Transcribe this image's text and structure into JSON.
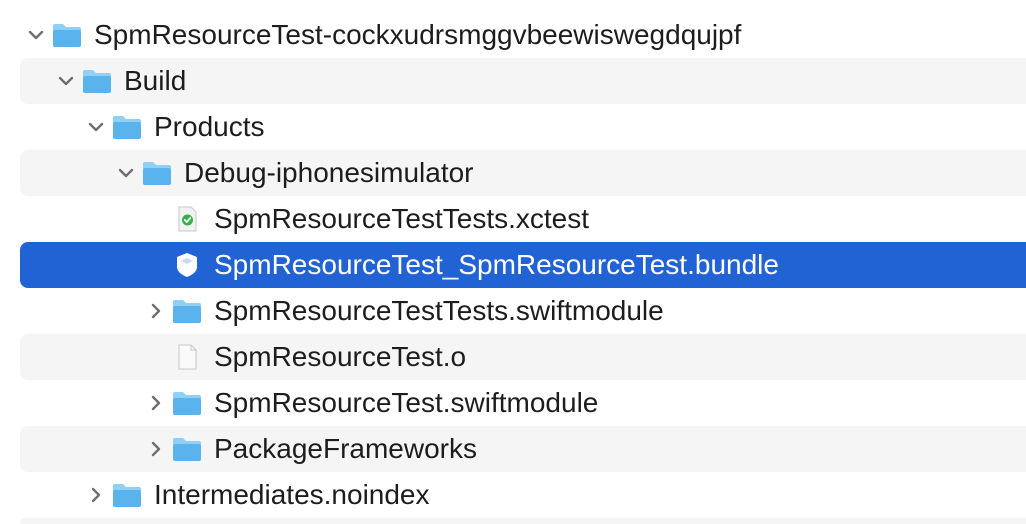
{
  "tree": {
    "items": [
      {
        "label": "SpmResourceTest-cockxudrsmggvbeewiswegdqujpf",
        "icon": "folder-icon",
        "disclosure": "expanded",
        "depth": 0,
        "selected": false
      },
      {
        "label": "Build",
        "icon": "folder-icon",
        "disclosure": "expanded",
        "depth": 1,
        "selected": false
      },
      {
        "label": "Products",
        "icon": "folder-icon",
        "disclosure": "expanded",
        "depth": 2,
        "selected": false
      },
      {
        "label": "Debug-iphonesimulator",
        "icon": "folder-icon",
        "disclosure": "expanded",
        "depth": 3,
        "selected": false
      },
      {
        "label": "SpmResourceTestTests.xctest",
        "icon": "xctest-file-icon",
        "disclosure": "none",
        "depth": 4,
        "selected": false
      },
      {
        "label": "SpmResourceTest_SpmResourceTest.bundle",
        "icon": "bundle-icon",
        "disclosure": "none",
        "depth": 4,
        "selected": true
      },
      {
        "label": "SpmResourceTestTests.swiftmodule",
        "icon": "folder-icon",
        "disclosure": "collapsed",
        "depth": 4,
        "selected": false
      },
      {
        "label": "SpmResourceTest.o",
        "icon": "document-icon",
        "disclosure": "none",
        "depth": 4,
        "selected": false
      },
      {
        "label": "SpmResourceTest.swiftmodule",
        "icon": "folder-icon",
        "disclosure": "collapsed",
        "depth": 4,
        "selected": false
      },
      {
        "label": "PackageFrameworks",
        "icon": "folder-icon",
        "disclosure": "collapsed",
        "depth": 4,
        "selected": false
      },
      {
        "label": "Intermediates.noindex",
        "icon": "folder-icon",
        "disclosure": "collapsed",
        "depth": 2,
        "selected": false
      }
    ]
  },
  "colors": {
    "selection": "#2163d5",
    "folder_light": "#8fd0f6",
    "folder_main": "#5ab3ec",
    "chevron": "#6e6e73",
    "badge_green": "#34b24a"
  }
}
